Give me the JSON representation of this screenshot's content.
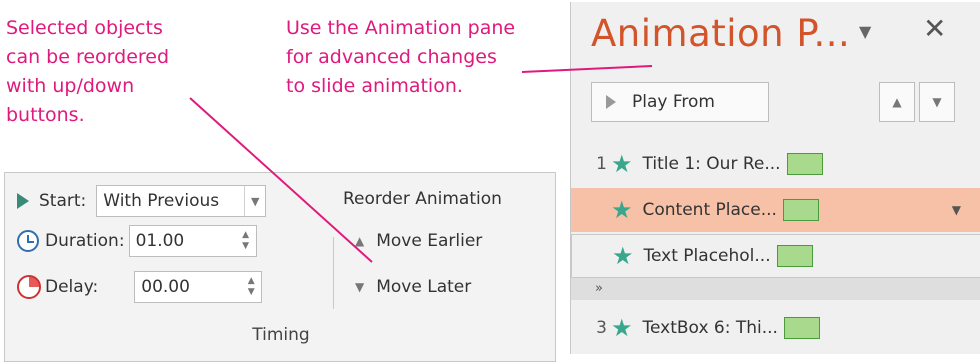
{
  "callouts": {
    "left": [
      "Selected objects",
      "can be reordered",
      "with up/down",
      "buttons."
    ],
    "right": [
      "Use the Animation pane",
      "for advanced changes",
      "to slide animation."
    ]
  },
  "ribbon": {
    "start_label": "Start:",
    "start_value": "With Previous",
    "reorder_title": "Reorder Animation",
    "duration_label": "Duration:",
    "duration_value": "01.00",
    "move_earlier": "Move Earlier",
    "delay_label": "Delay:",
    "delay_value": "00.00",
    "move_later": "Move Later",
    "group_label": "Timing"
  },
  "pane": {
    "title": "Animation P...",
    "play_from": "Play From",
    "items": [
      {
        "num": "1",
        "label": "Title 1: Our Re..."
      },
      {
        "num": "",
        "label": "Content Place..."
      },
      {
        "num": "",
        "label": "Text Placehol..."
      },
      {
        "num": "3",
        "label": "TextBox 6: Thi..."
      }
    ],
    "expand_glyph": "»"
  },
  "colors": {
    "callout": "#e0197d",
    "pane_title": "#d2542a",
    "selected_item": "#f6c1a6",
    "timing_bar": "#a9d98c",
    "star": "#3aa68c"
  }
}
